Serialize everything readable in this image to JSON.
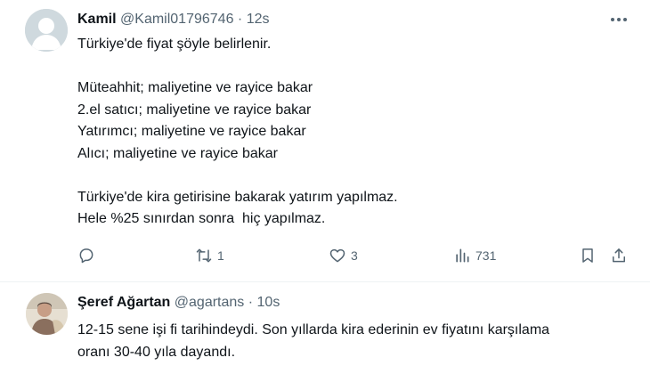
{
  "tweets": [
    {
      "name": "Kamil",
      "handle": "@Kamil01796746",
      "separator": "·",
      "time": "12s",
      "lines": [
        "Türkiye'de fiyat şöyle belirlenir.",
        "",
        "Müteahhit; maliyetine ve rayice bakar",
        "2.el satıcı; maliyetine ve rayice bakar",
        "Yatırımcı; maliyetine ve rayice bakar",
        "Alıcı; maliyetine ve rayice bakar",
        "",
        "Türkiye'de kira getirisine bakarak yatırım yapılmaz.",
        "Hele %25 sınırdan sonra  hiç yapılmaz."
      ],
      "actions": {
        "reply_icon": "reply-icon",
        "retweet_icon": "retweet-icon",
        "retweet_count": "1",
        "like_icon": "heart-icon",
        "like_count": "3",
        "views_icon": "views-chart-icon",
        "views_count": "731",
        "bookmark_icon": "bookmark-icon",
        "share_icon": "share-icon"
      }
    },
    {
      "name": "Şeref Ağartan",
      "handle": "@agartans",
      "separator": "·",
      "time": "10s",
      "lines": [
        "12-15 sene işi fi tarihindeydi. Son yıllarda kira ederinin ev fiyatını karşılama",
        "oranı 30-40 yıla dayandı."
      ]
    }
  ],
  "colors": {
    "text_primary": "#0f1419",
    "text_secondary": "#536471",
    "divider": "#eff3f4",
    "default_avatar_bg": "#cfd9de"
  }
}
